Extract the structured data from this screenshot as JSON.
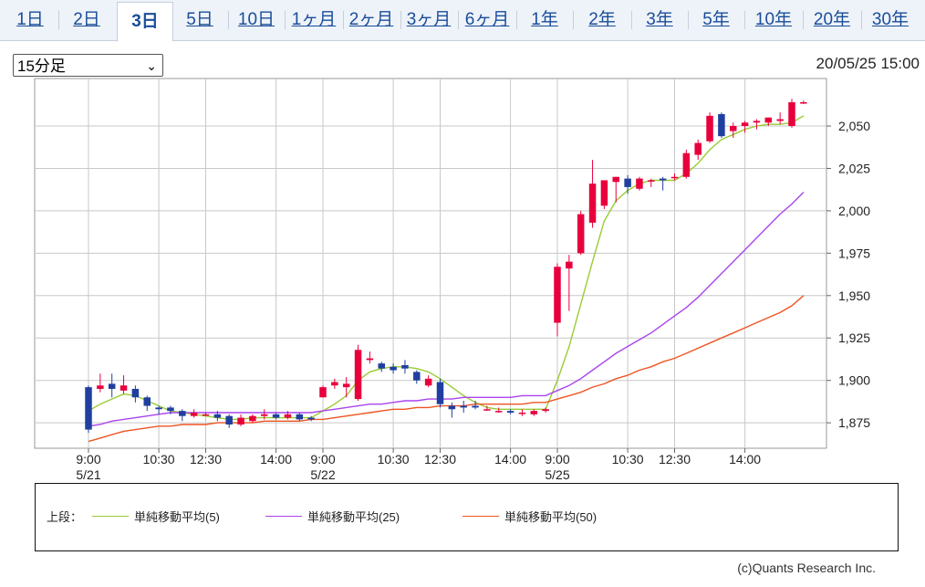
{
  "tabs": [
    {
      "label": "1日",
      "active": false
    },
    {
      "label": "2日",
      "active": false
    },
    {
      "label": "3日",
      "active": true
    },
    {
      "label": "5日",
      "active": false
    },
    {
      "label": "10日",
      "active": false
    },
    {
      "label": "1ヶ月",
      "active": false
    },
    {
      "label": "2ヶ月",
      "active": false
    },
    {
      "label": "3ヶ月",
      "active": false
    },
    {
      "label": "6ヶ月",
      "active": false
    },
    {
      "label": "1年",
      "active": false
    },
    {
      "label": "2年",
      "active": false
    },
    {
      "label": "3年",
      "active": false
    },
    {
      "label": "5年",
      "active": false
    },
    {
      "label": "10年",
      "active": false
    },
    {
      "label": "20年",
      "active": false
    },
    {
      "label": "30年",
      "active": false
    }
  ],
  "interval_select": {
    "value": "15分足"
  },
  "timestamp": "20/05/25 15:00",
  "legend": {
    "head": "上段：",
    "items": [
      {
        "label": "単純移動平均(5)",
        "color": "#99cc33"
      },
      {
        "label": "単純移動平均(25)",
        "color": "#aa44ee"
      },
      {
        "label": "単純移動平均(50)",
        "color": "#ee5522"
      }
    ]
  },
  "copyright": "(c)Quants Research Inc.",
  "colors": {
    "up": "#e8003d",
    "down": "#1f3fa0",
    "grid": "#c8c8c8"
  },
  "chart_data": {
    "type": "candlestick",
    "y_ticks": [
      "1,875",
      "1,900",
      "1,925",
      "1,950",
      "1,975",
      "2,000",
      "2,025",
      "2,050"
    ],
    "y_tick_values": [
      1875,
      1900,
      1925,
      1950,
      1975,
      2000,
      2025,
      2050
    ],
    "ylim": [
      1860,
      2078
    ],
    "x_ticks": [
      {
        "i": 0,
        "time": "9:00",
        "date": "5/21"
      },
      {
        "i": 6,
        "time": "10:30",
        "date": ""
      },
      {
        "i": 10,
        "time": "12:30",
        "date": ""
      },
      {
        "i": 16,
        "time": "14:00",
        "date": ""
      },
      {
        "i": 20,
        "time": "9:00",
        "date": "5/22"
      },
      {
        "i": 26,
        "time": "10:30",
        "date": ""
      },
      {
        "i": 30,
        "time": "12:30",
        "date": ""
      },
      {
        "i": 36,
        "time": "14:00",
        "date": ""
      },
      {
        "i": 40,
        "time": "9:00",
        "date": "5/25"
      },
      {
        "i": 46,
        "time": "10:30",
        "date": ""
      },
      {
        "i": 50,
        "time": "12:30",
        "date": ""
      },
      {
        "i": 56,
        "time": "14:00",
        "date": ""
      }
    ],
    "candles": [
      [
        1896,
        1897,
        1869,
        1871
      ],
      [
        1895,
        1904,
        1893,
        1897
      ],
      [
        1898,
        1904,
        1890,
        1895
      ],
      [
        1894,
        1903,
        1892,
        1897
      ],
      [
        1895,
        1897,
        1887,
        1890
      ],
      [
        1890,
        1891,
        1882,
        1885
      ],
      [
        1884,
        1885,
        1880,
        1883
      ],
      [
        1884,
        1885,
        1880,
        1882
      ],
      [
        1882,
        1883,
        1876,
        1879
      ],
      [
        1879,
        1883,
        1878,
        1881
      ],
      [
        1880,
        1881,
        1879,
        1880
      ],
      [
        1880,
        1882,
        1876,
        1878
      ],
      [
        1879,
        1880,
        1872,
        1874
      ],
      [
        1874,
        1880,
        1873,
        1878
      ],
      [
        1876,
        1880,
        1875,
        1879
      ],
      [
        1879,
        1883,
        1877,
        1880
      ],
      [
        1880,
        1881,
        1877,
        1878
      ],
      [
        1878,
        1882,
        1877,
        1880
      ],
      [
        1880,
        1881,
        1876,
        1877
      ],
      [
        1878,
        1879,
        1876,
        1877
      ],
      [
        1890,
        1897,
        1890,
        1896
      ],
      [
        1897,
        1901,
        1895,
        1899
      ],
      [
        1896,
        1902,
        1890,
        1898
      ],
      [
        1889,
        1921,
        1888,
        1918
      ],
      [
        1912,
        1917,
        1910,
        1913
      ],
      [
        1910,
        1911,
        1905,
        1907
      ],
      [
        1908,
        1910,
        1904,
        1906
      ],
      [
        1909,
        1912,
        1904,
        1907
      ],
      [
        1905,
        1906,
        1898,
        1900
      ],
      [
        1897,
        1903,
        1896,
        1901
      ],
      [
        1899,
        1901,
        1884,
        1886
      ],
      [
        1885,
        1887,
        1878,
        1883
      ],
      [
        1885,
        1888,
        1881,
        1884
      ],
      [
        1885,
        1888,
        1883,
        1884
      ],
      [
        1883,
        1885,
        1882,
        1883
      ],
      [
        1882,
        1884,
        1881,
        1882
      ],
      [
        1882,
        1883,
        1880,
        1881
      ],
      [
        1881,
        1883,
        1879,
        1881
      ],
      [
        1880,
        1883,
        1879,
        1882
      ],
      [
        1882,
        1884,
        1881,
        1883
      ],
      [
        1934,
        1969,
        1926,
        1967
      ],
      [
        1966,
        1974,
        1941,
        1970
      ],
      [
        1975,
        2000,
        1974,
        1998
      ],
      [
        1993,
        2030,
        1990,
        2016
      ],
      [
        2003,
        2018,
        2001,
        2018
      ],
      [
        2017,
        2020,
        2005,
        2020
      ],
      [
        2019,
        2021,
        2010,
        2014
      ],
      [
        2013,
        2020,
        2012,
        2019
      ],
      [
        2018,
        2019,
        2014,
        2018
      ],
      [
        2019,
        2020,
        2012,
        2018
      ],
      [
        2020,
        2022,
        2018,
        2020
      ],
      [
        2020,
        2036,
        2019,
        2034
      ],
      [
        2033,
        2042,
        2030,
        2040
      ],
      [
        2041,
        2058,
        2040,
        2056
      ],
      [
        2057,
        2058,
        2043,
        2044
      ],
      [
        2047,
        2052,
        2043,
        2050
      ],
      [
        2050,
        2053,
        2046,
        2052
      ],
      [
        2052,
        2054,
        2048,
        2053
      ],
      [
        2052,
        2055,
        2050,
        2055
      ],
      [
        2053,
        2058,
        2051,
        2054
      ],
      [
        2050,
        2066,
        2049,
        2064
      ],
      [
        2064,
        2065,
        2063,
        2064
      ]
    ],
    "series": [
      {
        "name": "単純移動平均(5)",
        "color": "#99cc33",
        "values": [
          1882,
          1886,
          1889,
          1892,
          1891,
          1888,
          1885,
          1882,
          1881,
          1880,
          1879,
          1878,
          1877,
          1877,
          1878,
          1878,
          1878,
          1878,
          1878,
          1878,
          1882,
          1886,
          1891,
          1900,
          1905,
          1907,
          1908,
          1908,
          1907,
          1905,
          1901,
          1896,
          1891,
          1887,
          1884,
          1883,
          1883,
          1883,
          1883,
          1883,
          1900,
          1920,
          1945,
          1970,
          1994,
          2006,
          2012,
          2016,
          2018,
          2018,
          2018,
          2022,
          2028,
          2036,
          2042,
          2045,
          2048,
          2050,
          2051,
          2051,
          2052,
          2056
        ]
      },
      {
        "name": "単純移動平均(25)",
        "color": "#aa44ee",
        "values": [
          1873,
          1874,
          1876,
          1877,
          1878,
          1879,
          1880,
          1881,
          1881,
          1881,
          1881,
          1881,
          1881,
          1881,
          1881,
          1881,
          1881,
          1881,
          1881,
          1881,
          1882,
          1883,
          1884,
          1885,
          1886,
          1886,
          1887,
          1888,
          1888,
          1889,
          1889,
          1889,
          1890,
          1890,
          1890,
          1890,
          1890,
          1891,
          1891,
          1891,
          1894,
          1897,
          1901,
          1906,
          1911,
          1916,
          1920,
          1924,
          1928,
          1933,
          1938,
          1943,
          1949,
          1956,
          1963,
          1970,
          1977,
          1984,
          1991,
          1998,
          2004,
          2011
        ]
      },
      {
        "name": "単純移動平均(50)",
        "color": "#ee5522",
        "values": [
          1864,
          1866,
          1868,
          1870,
          1871,
          1872,
          1873,
          1873,
          1874,
          1874,
          1874,
          1875,
          1875,
          1875,
          1875,
          1876,
          1876,
          1876,
          1876,
          1877,
          1877,
          1878,
          1879,
          1880,
          1881,
          1882,
          1883,
          1883,
          1884,
          1884,
          1885,
          1885,
          1885,
          1886,
          1886,
          1886,
          1886,
          1886,
          1887,
          1887,
          1889,
          1891,
          1893,
          1896,
          1898,
          1901,
          1903,
          1906,
          1908,
          1911,
          1913,
          1916,
          1919,
          1922,
          1925,
          1928,
          1931,
          1934,
          1937,
          1940,
          1944,
          1950
        ]
      }
    ]
  }
}
